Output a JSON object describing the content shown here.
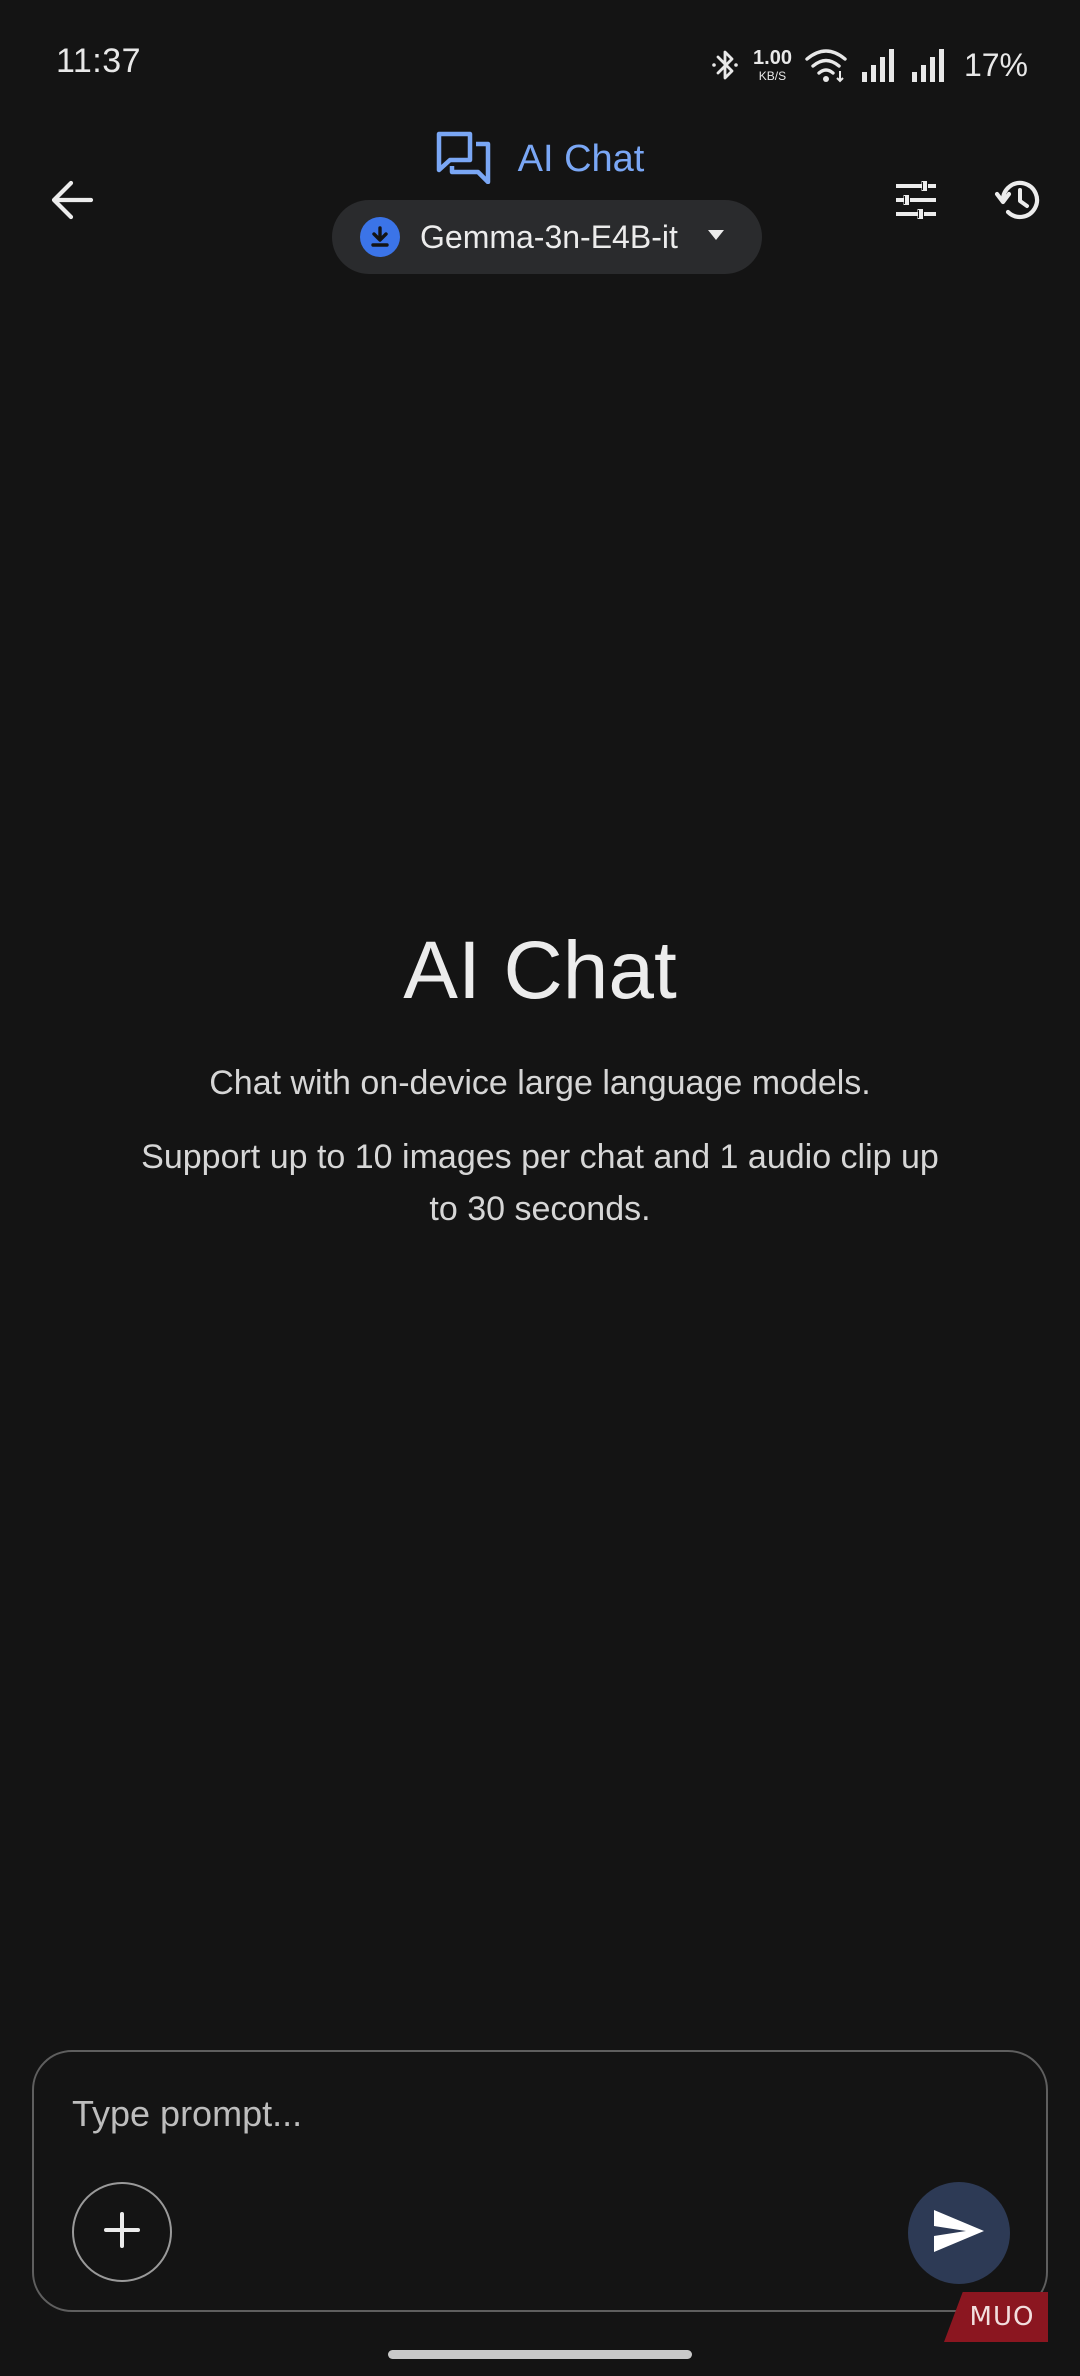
{
  "status_bar": {
    "time": "11:37",
    "net_speed_value": "1.00",
    "net_speed_unit": "KB/S",
    "battery": "17%",
    "icons": [
      "bluetooth-icon",
      "wifi-icon",
      "signal-icon",
      "signal-icon",
      "battery-text"
    ]
  },
  "header": {
    "title": "AI Chat",
    "model_name": "Gemma-3n-E4B-it",
    "icons": {
      "back": "arrow-back-icon",
      "title": "forum-icon",
      "model": "download-icon",
      "settings": "tune-icon",
      "history": "history-icon"
    }
  },
  "intro": {
    "title": "AI Chat",
    "subtitle": "Chat with on-device large language models.",
    "note": "Support up to 10 images per chat and 1 audio clip up to 30 seconds."
  },
  "composer": {
    "placeholder": "Type prompt...",
    "icons": {
      "add": "plus-icon",
      "send": "send-icon"
    }
  },
  "watermark": {
    "text": "MUO"
  },
  "colors": {
    "background": "#141414",
    "accent": "#7aa7f5",
    "chip": "#2a2b2d",
    "download_badge": "#3b74e8",
    "send_button": "#2d3a55",
    "watermark": "#8b1620"
  }
}
